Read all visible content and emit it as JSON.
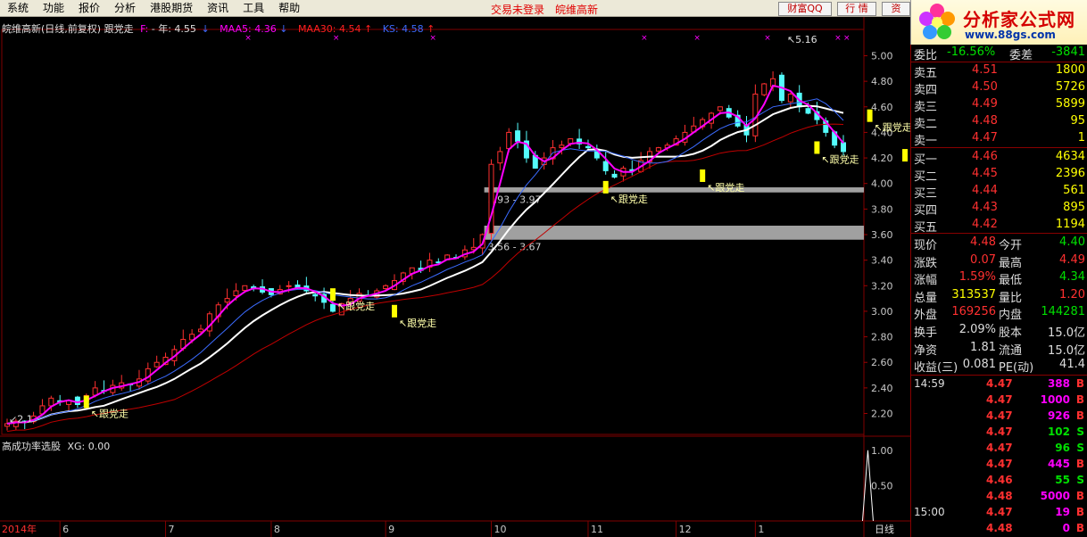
{
  "menu": {
    "items": [
      "系统",
      "功能",
      "报价",
      "分析",
      "港股期货",
      "资讯",
      "工具",
      "帮助"
    ],
    "login_status": "交易未登录",
    "stock_name_title": "皖维高新",
    "buttons": [
      "财富QQ",
      "行 情",
      "资"
    ]
  },
  "logo": {
    "title": "分析家公式网",
    "url": "www.88gs.com"
  },
  "chart_header": {
    "title": "皖维高新(日线,前复权) 跟党走",
    "f_label": "F:",
    "f_value": "- 年: 4.55",
    "maa5_label": "MAA5:",
    "maa5_value": "4.36",
    "maa30_label": "MAA30:",
    "maa30_value": "4.54",
    "ks_label": "KS:",
    "ks_value": "4.58",
    "colors": {
      "maa5": "#ff00ff",
      "maa30": "#ff2020",
      "ks": "#3b6bff"
    }
  },
  "sub_header": {
    "label": "高成功率选股",
    "value_label": "XG:",
    "value": "0.00"
  },
  "bottom_bar": {
    "period": "日线",
    "year": "2014年"
  },
  "chart_data": {
    "type": "candlestick",
    "y_ticks": [
      5.0,
      4.8,
      4.6,
      4.4,
      4.2,
      4.0,
      3.8,
      3.6,
      3.4,
      3.2,
      3.0,
      2.8,
      2.6,
      2.4,
      2.2
    ],
    "ylim": [
      2.05,
      5.15
    ],
    "x_month_labels": [
      "6",
      "7",
      "8",
      "9",
      "10",
      "11",
      "12",
      "1"
    ],
    "high_label": "5.16",
    "low_label": "2.1",
    "signal_label": "跟党走",
    "gap_zones": [
      {
        "label": "3.93 - 3.97",
        "low": 3.93,
        "high": 3.97
      },
      {
        "label": "3.56 - 3.67",
        "low": 3.56,
        "high": 3.67
      }
    ],
    "sub_y_ticks": [
      1.0,
      0.5
    ],
    "sub_ylim": [
      0,
      1.2
    ],
    "signal_markers": [
      {
        "index": 9,
        "price": 2.27
      },
      {
        "index": 37,
        "price": 3.11
      },
      {
        "index": 44,
        "price": 2.98
      },
      {
        "index": 68,
        "price": 3.95
      },
      {
        "index": 79,
        "price": 4.04
      },
      {
        "index": 92,
        "price": 4.26
      },
      {
        "index": 98,
        "price": 4.51
      },
      {
        "index": 102,
        "price": 4.2
      }
    ],
    "closes": [
      2.12,
      2.14,
      2.13,
      2.18,
      2.26,
      2.32,
      2.29,
      2.3,
      2.27,
      2.34,
      2.4,
      2.38,
      2.42,
      2.44,
      2.43,
      2.47,
      2.55,
      2.6,
      2.64,
      2.7,
      2.78,
      2.82,
      2.86,
      2.98,
      3.05,
      3.1,
      3.16,
      3.2,
      3.18,
      3.15,
      3.13,
      3.17,
      3.2,
      3.18,
      3.16,
      3.12,
      3.07,
      3.0,
      3.06,
      3.1,
      3.14,
      3.12,
      3.16,
      3.2,
      3.24,
      3.3,
      3.34,
      3.32,
      3.4,
      3.38,
      3.44,
      3.42,
      3.48,
      3.5,
      3.6,
      4.15,
      4.25,
      4.4,
      4.33,
      4.2,
      4.12,
      4.2,
      4.28,
      4.3,
      4.35,
      4.31,
      4.28,
      4.2,
      4.1,
      4.05,
      4.12,
      4.1,
      4.18,
      4.25,
      4.28,
      4.3,
      4.35,
      4.4,
      4.45,
      4.5,
      4.55,
      4.6,
      4.52,
      4.45,
      4.38,
      4.7,
      4.78,
      4.82,
      4.65,
      4.7,
      4.6,
      4.55,
      4.5,
      4.4,
      4.3,
      4.25
    ],
    "xg_spike": {
      "index": 99,
      "value": 1.0
    }
  },
  "quote": {
    "header_labels": [
      "委比",
      "委差"
    ],
    "header_values": [
      "-16.56%",
      "-3841"
    ],
    "asks": [
      {
        "label": "卖五",
        "price": "4.51",
        "vol": "1800"
      },
      {
        "label": "卖四",
        "price": "4.50",
        "vol": "5726"
      },
      {
        "label": "卖三",
        "price": "4.49",
        "vol": "5899"
      },
      {
        "label": "卖二",
        "price": "4.48",
        "vol": "95"
      },
      {
        "label": "卖一",
        "price": "4.47",
        "vol": "1"
      }
    ],
    "bids": [
      {
        "label": "买一",
        "price": "4.46",
        "vol": "4634"
      },
      {
        "label": "买二",
        "price": "4.45",
        "vol": "2396"
      },
      {
        "label": "买三",
        "price": "4.44",
        "vol": "561"
      },
      {
        "label": "买四",
        "price": "4.43",
        "vol": "895"
      },
      {
        "label": "买五",
        "price": "4.42",
        "vol": "1194"
      }
    ],
    "stats": [
      {
        "l1": "现价",
        "v1": "4.48",
        "c1": "#ff3030",
        "l2": "今开",
        "v2": "4.40",
        "c2": "#00e000"
      },
      {
        "l1": "涨跌",
        "v1": "0.07",
        "c1": "#ff3030",
        "l2": "最高",
        "v2": "4.49",
        "c2": "#ff3030"
      },
      {
        "l1": "涨幅",
        "v1": "1.59%",
        "c1": "#ff3030",
        "l2": "最低",
        "v2": "4.34",
        "c2": "#00e000"
      },
      {
        "l1": "总量",
        "v1": "313537",
        "c1": "#ffff00",
        "l2": "量比",
        "v2": "1.20",
        "c2": "#ff3030"
      },
      {
        "l1": "外盘",
        "v1": "169256",
        "c1": "#ff3030",
        "l2": "内盘",
        "v2": "144281",
        "c2": "#00e000"
      },
      {
        "l1": "换手",
        "v1": "2.09%",
        "c1": "#dddddd",
        "l2": "股本",
        "v2": "15.0亿",
        "c2": "#dddddd"
      },
      {
        "l1": "净资",
        "v1": "1.81",
        "c1": "#dddddd",
        "l2": "流通",
        "v2": "15.0亿",
        "c2": "#dddddd"
      },
      {
        "l1": "收益(三)",
        "v1": "0.081",
        "c1": "#dddddd",
        "l2": "PE(动)",
        "v2": "41.4",
        "c2": "#dddddd"
      }
    ],
    "ticks": [
      {
        "time": "14:59",
        "price": "4.47",
        "vol": "388",
        "side": "B"
      },
      {
        "time": "",
        "price": "4.47",
        "vol": "1000",
        "side": "B"
      },
      {
        "time": "",
        "price": "4.47",
        "vol": "926",
        "side": "B"
      },
      {
        "time": "",
        "price": "4.47",
        "vol": "102",
        "side": "S"
      },
      {
        "time": "",
        "price": "4.47",
        "vol": "96",
        "side": "S"
      },
      {
        "time": "",
        "price": "4.47",
        "vol": "445",
        "side": "B"
      },
      {
        "time": "",
        "price": "4.46",
        "vol": "55",
        "side": "S"
      },
      {
        "time": "",
        "price": "4.48",
        "vol": "5000",
        "side": "B"
      },
      {
        "time": "15:00",
        "price": "4.47",
        "vol": "19",
        "side": "B"
      },
      {
        "time": "",
        "price": "4.48",
        "vol": "0",
        "side": "B"
      }
    ]
  }
}
